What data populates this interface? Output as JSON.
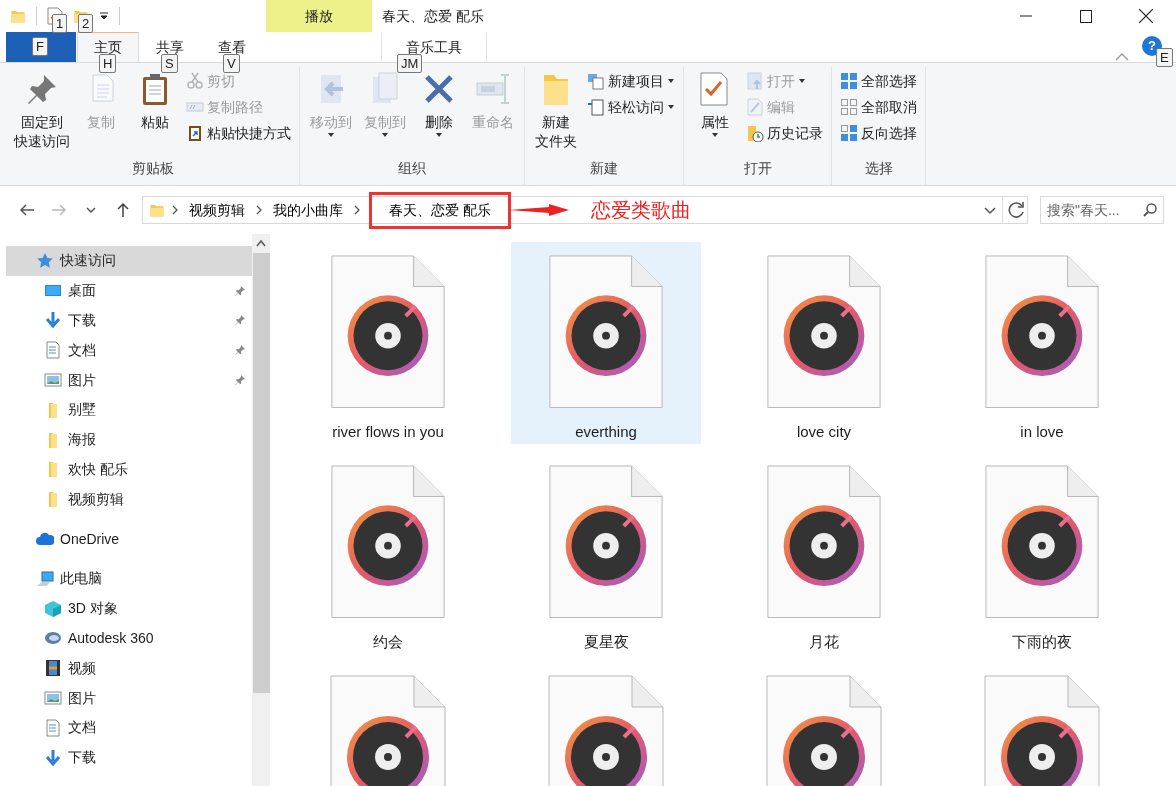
{
  "window": {
    "title": "春天、恋爱 配乐",
    "context_tab_group": "播放",
    "quick_access_keytips": [
      "1",
      "2"
    ],
    "help_label": "?",
    "help_keytip": "E"
  },
  "tabs": [
    {
      "kind": "file",
      "selected": false,
      "keytip": "F"
    },
    {
      "label": "主页",
      "kind": "normal",
      "selected": true,
      "keytip": "H"
    },
    {
      "label": "共享",
      "kind": "normal",
      "selected": false,
      "keytip": "S"
    },
    {
      "label": "查看",
      "kind": "normal",
      "selected": false,
      "keytip": "V"
    },
    {
      "label": "音乐工具",
      "kind": "contextual",
      "selected": false,
      "keytip": "JM"
    }
  ],
  "ribbon": {
    "groups": [
      {
        "label": "剪贴板",
        "commands": [
          {
            "lines": [
              "固定到",
              "快速访问"
            ],
            "kind": "large",
            "disabled": false,
            "dropdown": false
          },
          {
            "label": "复制",
            "kind": "large",
            "disabled": true,
            "dropdown": false
          },
          {
            "label": "粘贴",
            "kind": "large",
            "disabled": false,
            "dropdown": false
          },
          {
            "label": "剪切",
            "kind": "small",
            "disabled": true,
            "dropdown": false
          },
          {
            "label": "复制路径",
            "kind": "small",
            "disabled": true,
            "dropdown": false
          },
          {
            "label": "粘贴快捷方式",
            "kind": "small",
            "disabled": false,
            "dropdown": false
          }
        ]
      },
      {
        "label": "组织",
        "commands": [
          {
            "label": "移动到",
            "kind": "large",
            "disabled": true,
            "dropdown": true
          },
          {
            "label": "复制到",
            "kind": "large",
            "disabled": true,
            "dropdown": true
          },
          {
            "label": "删除",
            "kind": "large",
            "disabled": false,
            "dropdown": true
          },
          {
            "label": "重命名",
            "kind": "large",
            "disabled": true,
            "dropdown": false
          }
        ]
      },
      {
        "label": "新建",
        "commands": [
          {
            "lines": [
              "新建",
              "文件夹"
            ],
            "kind": "large",
            "disabled": false,
            "dropdown": false
          },
          {
            "label": "新建项目",
            "kind": "small",
            "disabled": false,
            "dropdown": true
          },
          {
            "label": "轻松访问",
            "kind": "small",
            "disabled": false,
            "dropdown": true
          }
        ]
      },
      {
        "label": "打开",
        "commands": [
          {
            "label": "属性",
            "kind": "large",
            "disabled": false,
            "dropdown": true
          },
          {
            "label": "打开",
            "kind": "small",
            "disabled": true,
            "dropdown": true
          },
          {
            "label": "编辑",
            "kind": "small",
            "disabled": true,
            "dropdown": false
          },
          {
            "label": "历史记录",
            "kind": "small",
            "disabled": false,
            "dropdown": false
          }
        ]
      },
      {
        "label": "选择",
        "commands": [
          {
            "label": "全部选择",
            "kind": "small",
            "disabled": false,
            "dropdown": false
          },
          {
            "label": "全部取消",
            "kind": "small",
            "disabled": false,
            "dropdown": false
          },
          {
            "label": "反向选择",
            "kind": "small",
            "disabled": false,
            "dropdown": false
          }
        ]
      }
    ]
  },
  "address": {
    "breadcrumbs": [
      {
        "label": "视频剪辑",
        "boxed": false
      },
      {
        "label": "我的小曲库",
        "boxed": false
      },
      {
        "label": "春天、恋爱 配乐",
        "boxed": true
      }
    ],
    "annotation": "恋爱类歌曲",
    "search": {
      "placeholder": "搜索\"春天..."
    }
  },
  "sidebar": {
    "items": [
      {
        "label": "快速访问",
        "kind": "star",
        "selected": true,
        "children": [
          {
            "label": "桌面",
            "kind": "desktop",
            "selected": false,
            "pinned": true
          },
          {
            "label": "下载",
            "kind": "download",
            "selected": false,
            "pinned": true
          },
          {
            "label": "文档",
            "kind": "document",
            "selected": false,
            "pinned": true
          },
          {
            "label": "图片",
            "kind": "picture",
            "selected": false,
            "pinned": true
          },
          {
            "label": "别墅",
            "kind": "folder",
            "selected": false,
            "pinned": false
          },
          {
            "label": "海报",
            "kind": "folder",
            "selected": false,
            "pinned": false
          },
          {
            "label": "欢快  配乐",
            "kind": "folder",
            "selected": false,
            "pinned": false
          },
          {
            "label": "视频剪辑",
            "kind": "folder",
            "selected": false,
            "pinned": false
          }
        ]
      },
      {
        "label": "OneDrive",
        "kind": "cloud",
        "selected": false
      },
      {
        "label": "此电脑",
        "kind": "computer",
        "selected": false,
        "children": [
          {
            "label": "3D 对象",
            "kind": "cube",
            "selected": false,
            "pinned": false
          },
          {
            "label": "Autodesk 360",
            "kind": "swirl",
            "selected": false,
            "pinned": false
          },
          {
            "label": "视频",
            "kind": "video",
            "selected": false,
            "pinned": false
          },
          {
            "label": "图片",
            "kind": "picture",
            "selected": false,
            "pinned": false
          },
          {
            "label": "文档",
            "kind": "document",
            "selected": false,
            "pinned": false
          },
          {
            "label": "下载",
            "kind": "download",
            "selected": false,
            "pinned": false
          }
        ]
      }
    ]
  },
  "files": [
    {
      "name": "river flows in you",
      "selected": false
    },
    {
      "name": "everthing",
      "selected": true
    },
    {
      "name": "love city",
      "selected": false
    },
    {
      "name": "in love",
      "selected": false
    },
    {
      "name": "约会",
      "selected": false
    },
    {
      "name": "夏星夜",
      "selected": false
    },
    {
      "name": "月花",
      "selected": false
    },
    {
      "name": "下雨的夜",
      "selected": false
    },
    {
      "selected": false
    },
    {
      "selected": false
    },
    {
      "selected": false
    },
    {
      "selected": false
    }
  ]
}
